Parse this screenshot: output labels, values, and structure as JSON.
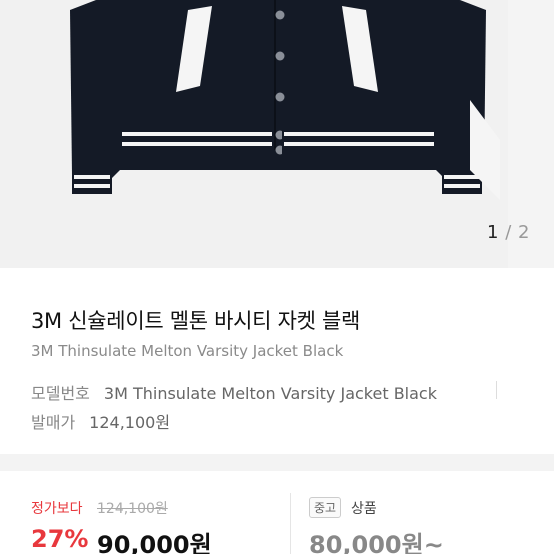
{
  "gallery": {
    "current": "1",
    "separator": "/",
    "total": "2"
  },
  "product": {
    "title": "3M 신슐레이트 멜톤 바시티 자켓 블랙",
    "subtitle": "3M Thinsulate Melton Varsity Jacket Black",
    "model_label": "모델번호",
    "model_value": "3M Thinsulate Melton Varsity Jacket Black",
    "release_label": "발매가",
    "release_value": "124,100원"
  },
  "pricing": {
    "regular_label": "정가보다",
    "regular_price": "124,100원",
    "discount": "27%",
    "sale_price": "90,000원",
    "used_badge": "중고",
    "used_label": "상품",
    "used_price": "80,000원~"
  },
  "colors": {
    "accent_red": "#e8383d",
    "jacket_body": "#141a26",
    "image_bg": "#f1f1f1"
  }
}
